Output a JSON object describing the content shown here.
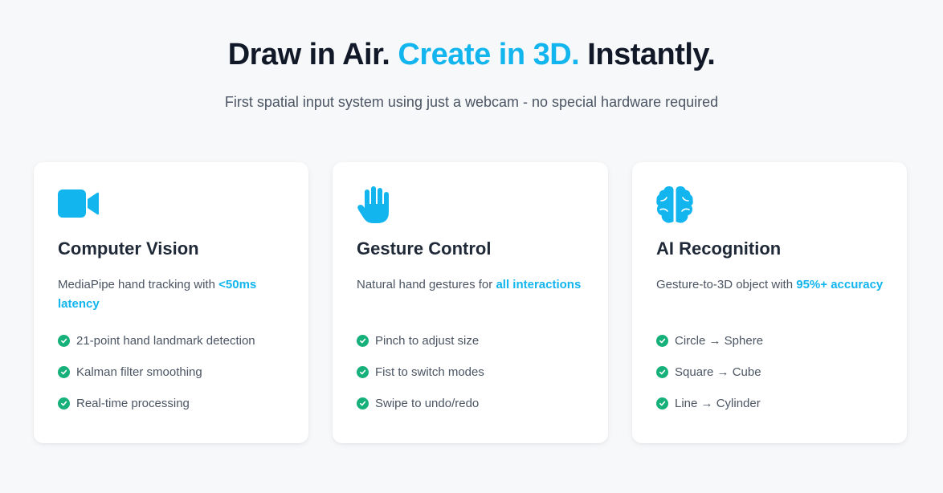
{
  "colors": {
    "accent": "#12b5ee",
    "check": "#16b07a",
    "background": "#f7f8fa"
  },
  "hero": {
    "title_part1": "Draw in Air.",
    "title_accent": "Create in 3D.",
    "title_part2": "Instantly.",
    "subtitle": "First spatial input system using just a webcam - no special hardware required"
  },
  "cards": [
    {
      "icon": "video-camera-icon",
      "title": "Computer Vision",
      "desc_prefix": "MediaPipe hand tracking with",
      "desc_highlight": "<50ms latency",
      "features": [
        "21-point hand landmark detection",
        "Kalman filter smoothing",
        "Real-time processing"
      ]
    },
    {
      "icon": "hand-icon",
      "title": "Gesture Control",
      "desc_prefix": "Natural hand gestures for",
      "desc_highlight": "all interactions",
      "features": [
        "Pinch to adjust size",
        "Fist to switch modes",
        "Swipe to undo/redo"
      ]
    },
    {
      "icon": "brain-icon",
      "title": "AI Recognition",
      "desc_prefix": "Gesture-to-3D object with",
      "desc_highlight": "95%+ accuracy",
      "features": [
        "Circle → Sphere",
        "Square → Cube",
        "Line → Cylinder"
      ]
    }
  ]
}
